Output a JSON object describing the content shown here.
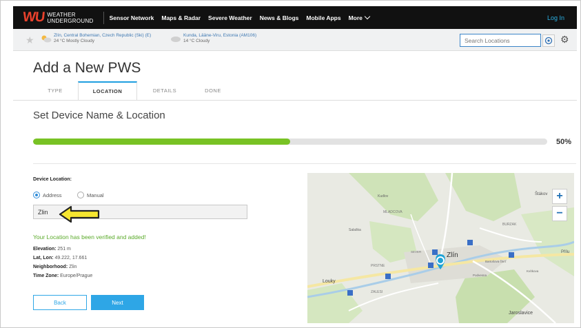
{
  "nav": {
    "logo_mark": "WU",
    "logo_line1": "WEATHER",
    "logo_line2": "UNDERGROUND",
    "links": [
      "Sensor Network",
      "Maps & Radar",
      "Severe Weather",
      "News & Blogs",
      "Mobile Apps",
      "More"
    ],
    "login": "Log In"
  },
  "favorites": [
    {
      "line1": "Zlín, Central Bohemian, Czech Republic (Ski) (E)",
      "line2": "24 °C Mostly Cloudy"
    },
    {
      "line1": "Kunda, Lääne-Viru, Estonia (AM106)",
      "line2": "14 °C Cloudy"
    }
  ],
  "search": {
    "placeholder": "Search Locations"
  },
  "page": {
    "title": "Add a New PWS",
    "tabs": [
      "TYPE",
      "LOCATION",
      "DETAILS",
      "DONE"
    ],
    "active_tab": 1,
    "section_title": "Set Device Name & Location",
    "progress": 50,
    "progress_label": "50%"
  },
  "form": {
    "device_location_label": "Device Location:",
    "radio_address": "Address",
    "radio_manual": "Manual",
    "address_value": "Zlin",
    "verified_msg": "Your Location has been verified and added!",
    "elevation_label": "Elevation:",
    "elevation_value": "251 m",
    "latlon_label": "Lat, Lon:",
    "latlon_value": "49.222, 17.661",
    "neighborhood_label": "Neighborhood:",
    "neighborhood_value": "Zlin",
    "timezone_label": "Time Zone:",
    "timezone_value": "Europe/Prague",
    "back_label": "Back",
    "next_label": "Next"
  },
  "map": {
    "labels": {
      "zlin": "Zlín",
      "louky": "Louky",
      "jaroslavice": "Jaroslavice",
      "mladcova": "MLADCOVA",
      "burzak": "BURZAK",
      "prstne": "PRSTNE",
      "zalesi": "ZALESI",
      "sikov": "Štákov",
      "prilu": "Přílu",
      "kudlov": "Kudlov",
      "salasky": "Salaška",
      "bartos": "Bartošova čtvrť",
      "sever": "SEVER",
      "podvesna": "Podvesna",
      "kvitkova": "Kvítkova"
    },
    "zoom_in": "+",
    "zoom_out": "−"
  },
  "colors": {
    "accent": "#2ea6e6",
    "progress": "#78c224",
    "verified": "#5aaa2a",
    "pin": "#1fa3d6"
  }
}
